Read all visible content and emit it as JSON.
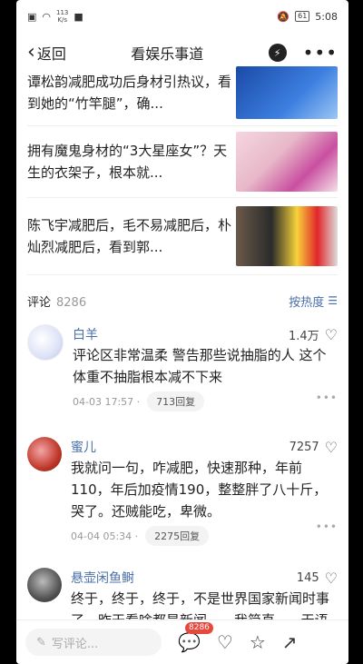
{
  "status_bar": {
    "net_speed": "113",
    "net_unit": "K/s",
    "battery": "61",
    "time": "5:08"
  },
  "nav": {
    "back_label": "返回",
    "title": "看娱乐事道"
  },
  "articles": [
    {
      "title": "谭松韵减肥成功后身材引热议，看到她的“竹竿腿”，确..."
    },
    {
      "title": "拥有魔鬼身材的“3大星座女”？天生的衣架子，根本就..."
    },
    {
      "title": "陈飞宇减肥后，毛不易减肥后，朴灿烈减肥后，看到郭..."
    }
  ],
  "comments_header": {
    "label": "评论",
    "count": "8286",
    "sort_label": "按热度"
  },
  "comments": [
    {
      "user": "白羊",
      "likes": "1.4万",
      "text": "评论区非常温柔 警告那些说抽脂的人 这个体重不抽脂根本减不下来",
      "time": "04-03 17:57 ·",
      "replies": "713回复"
    },
    {
      "user": "蜜儿",
      "likes": "7257",
      "text": "我就问一句，咋减肥，快速那种，年前110，年后加疫情190，整整胖了八十斤，哭了。还贼能吃，卑微。",
      "time": "04-04 05:34 ·",
      "replies": "2275回复"
    },
    {
      "user": "悬壶闲鱼鲥",
      "likes": "145",
      "text": "终于，终于，终于，不是世界国家新闻时事了，昨天看啥都是新闻，，，我简直......无语了😂😂😂😂😂"
    }
  ],
  "bottom_bar": {
    "write_placeholder": "写评论...",
    "comment_badge": "8286"
  },
  "icons": [
    "wifi-icon",
    "battery-icon",
    "chevron-left-icon",
    "bolt-icon",
    "more-icon",
    "sort-icon",
    "heart-icon",
    "pen-icon",
    "comment-icon",
    "star-icon",
    "share-icon"
  ],
  "colors": {
    "accent_blue": "#4a6fa8",
    "badge_red": "#e8473c"
  }
}
